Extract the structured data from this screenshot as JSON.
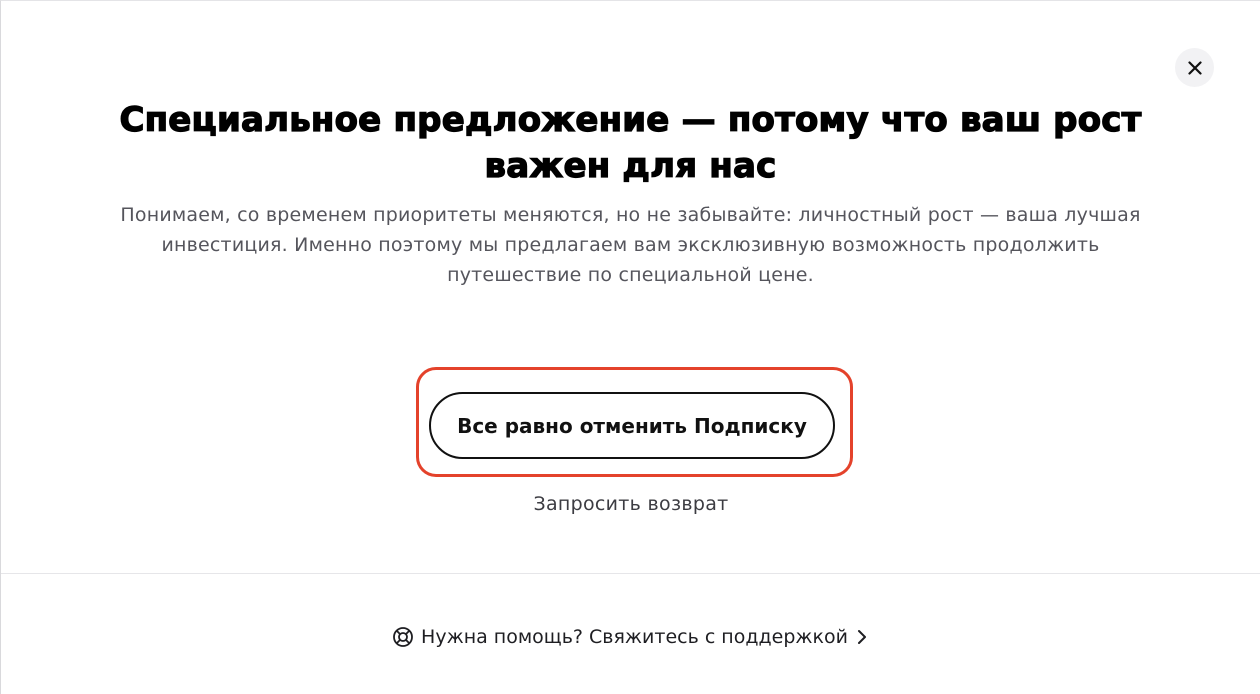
{
  "dialog": {
    "title": "Специальное предложение — потому что ваш рост важен для нас",
    "subtitle": "Понимаем, со временем приоритеты меняются, но не забывайте: личностный рост — ваша лучшая инвестиция. Именно поэтому мы предлагаем вам эксклюзивную возможность продолжить путешествие по специальной цене.",
    "cancel_button_label": "Все равно отменить Подписку",
    "refund_link_label": "Запросить возврат",
    "support_link_label": "Нужна помощь? Свяжитесь с поддержкой",
    "close_icon": "close-icon",
    "support_icon": "lifebuoy-icon",
    "chevron_icon": "chevron-right-icon"
  },
  "colors": {
    "highlight": "#e4422b",
    "text_primary": "#111111",
    "text_secondary": "#55555c",
    "close_bg": "#f2f2f4"
  }
}
